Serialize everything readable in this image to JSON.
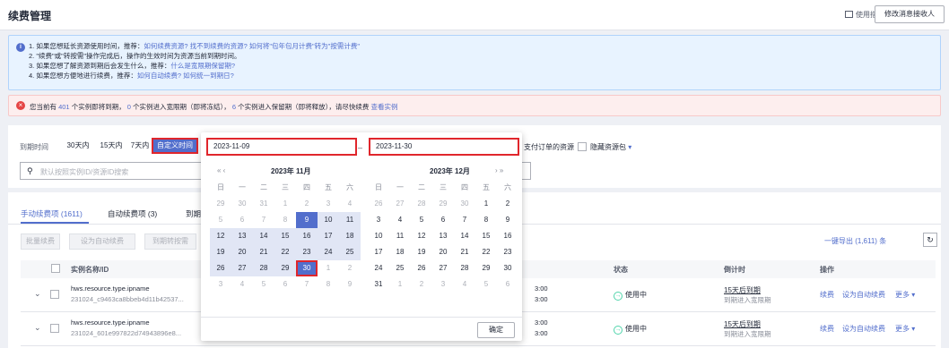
{
  "header": {
    "title": "续费管理",
    "guide": "使用指南",
    "modify": "修改消息接收人"
  },
  "info": {
    "l1a": "1. 如果您想延长资源使用时间，推荐：",
    "l1b": "如何续费资源? 找不到续费的资源? 如何将\"包年包月计费\"转为\"按需计费\"",
    "l2": "2. \"续费\"或\"转按需\"操作完成后，操作的生效时间为资源当前到期时间。",
    "l3a": "3. 如果您想了解资源到期后会发生什么，推荐：",
    "l3b": "什么是宽限期保留期?",
    "l4a": "4. 如果您想方便地进行续费，推荐：",
    "l4b": "如何自动续费? 如何统一到期日?"
  },
  "warn": {
    "t1": "您当前有",
    "n1": "401",
    "t2": "个实例即将到期，",
    "n2": "0",
    "t3": "个实例进入宽限期（即将冻结），",
    "n3": "6",
    "t4": "个实例进入保留期（即将释放），请尽快续费",
    "link": "查看实例"
  },
  "filter": {
    "label": "到期时间",
    "d30": "30天内",
    "d15": "15天内",
    "d7": "7天内",
    "custom": "自定义时间",
    "order": "支付订单的资源",
    "hide": "隐藏资源包",
    "search_ph": "默认按照实例ID/资源ID搜索"
  },
  "tabs": {
    "manual": "手动续费项 (1611)",
    "auto": "自动续费项 (3)",
    "due": "到期"
  },
  "actions": {
    "batch": "批量续费",
    "set_auto": "设为自动续费",
    "to_due": "到期转按需",
    "export": "一键导出 (1,611) 条"
  },
  "table": {
    "h_name": "实例名称/ID",
    "h_status": "状态",
    "h_countdown": "倒计时",
    "h_op": "操作"
  },
  "rows": [
    {
      "name": "hws.resource.type.ipname",
      "id": "231024_c9463ca8bbeb4d11b42537...",
      "v": "\\",
      "t1": "3:00",
      "t2": "3:00",
      "status": "使用中",
      "cd": "15天后到期",
      "cd2": "到期进入宽限期",
      "op1": "续费",
      "op2": "设为自动续费",
      "op3": "更多"
    },
    {
      "name": "hws.resource.type.ipname",
      "id": "231024_601e997822d74943896e8...",
      "v": "\\",
      "t1": "3:00",
      "t2": "3:00",
      "status": "使用中",
      "cd": "15天后到期",
      "cd2": "到期进入宽限期",
      "op1": "续费",
      "op2": "设为自动续费",
      "op3": "更多"
    }
  ],
  "calendar": {
    "start": "2023-11-09",
    "end": "2023-11-30",
    "m1": "2023年 11月",
    "m2": "2023年 12月",
    "ok": "确定",
    "weekdays": [
      "日",
      "一",
      "二",
      "三",
      "四",
      "五",
      "六"
    ],
    "left": [
      [
        "29",
        "30",
        "31",
        "1",
        "2",
        "3",
        "4"
      ],
      [
        "5",
        "6",
        "7",
        "8",
        "9",
        "10",
        "11"
      ],
      [
        "12",
        "13",
        "14",
        "15",
        "16",
        "17",
        "18"
      ],
      [
        "19",
        "20",
        "21",
        "22",
        "23",
        "24",
        "25"
      ],
      [
        "26",
        "27",
        "28",
        "29",
        "30",
        "1",
        "2"
      ],
      [
        "3",
        "4",
        "5",
        "6",
        "7",
        "8",
        "9"
      ]
    ],
    "right": [
      [
        "26",
        "27",
        "28",
        "29",
        "30",
        "1",
        "2"
      ],
      [
        "3",
        "4",
        "5",
        "6",
        "7",
        "8",
        "9"
      ],
      [
        "10",
        "11",
        "12",
        "13",
        "14",
        "15",
        "16"
      ],
      [
        "17",
        "18",
        "19",
        "20",
        "21",
        "22",
        "23"
      ],
      [
        "24",
        "25",
        "26",
        "27",
        "28",
        "29",
        "30"
      ],
      [
        "31",
        "1",
        "2",
        "3",
        "4",
        "5",
        "6"
      ]
    ]
  },
  "colors": {
    "accent": "#526ecc",
    "red": "#e0262c",
    "ok": "#50d4ab"
  }
}
